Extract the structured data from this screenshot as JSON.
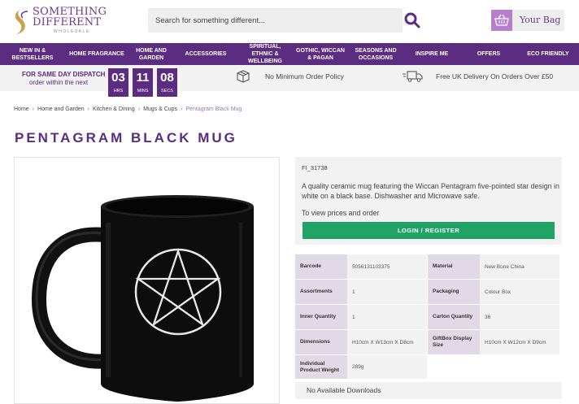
{
  "brand": {
    "line1": "SOMETHING",
    "line2": "DIFFERENT",
    "line3": "WHOLESALE",
    "accent": "#5b2c7f"
  },
  "search": {
    "placeholder": "Search for something different...",
    "icon": "search-icon"
  },
  "bag": {
    "label": "Your Bag",
    "icon": "basket-icon"
  },
  "nav": {
    "items": [
      "NEW IN & BESTSELLERS",
      "HOME FRAGRANCE",
      "HOME AND GARDEN",
      "ACCESSORIES",
      "SPIRITUAL, ETHNIC & WELLBEING",
      "GOTHIC, WICCAN & PAGAN",
      "SEASONS AND OCCASIONS",
      "INSPIRE ME",
      "OFFERS",
      "ECO FRIENDLY"
    ]
  },
  "dispatch": {
    "title": "FOR SAME DAY DISPATCH",
    "subtitle": "order within the next",
    "hours": "03",
    "hours_label": "HRS",
    "mins": "11",
    "mins_label": "MINS",
    "secs": "08",
    "secs_label": "SECS",
    "policy": "No Minimum Order Policy",
    "delivery": "Free UK Delivery On Orders Over £50"
  },
  "breadcrumb": {
    "items": [
      "Home",
      "Home and Garden",
      "Kitchen & Dining",
      "Mugs & Cups"
    ],
    "current": "Pentagram Black Mug"
  },
  "product": {
    "title": "PENTAGRAM BLACK MUG",
    "sku": "FI_31738",
    "description": "A quality ceramic mug featuring the Wiccan Pentagram five-pointed star design in white on a black base. Dishwasher and Microwave safe.",
    "view_prices": "To view prices and order",
    "login_label": "LOGIN / REGISTER"
  },
  "specs": {
    "barcode_label": "Barcode",
    "barcode": "5056131103375",
    "material_label": "Material",
    "material": "New Bone China",
    "assortments_label": "Assortments",
    "assortments": "1",
    "packaging_label": "Packaging",
    "packaging": "Colour Box",
    "inner_label": "Inner Quantity",
    "inner": "1",
    "carton_label": "Carton Quantity",
    "carton": "36",
    "dimensions_label": "Dimensions",
    "dimensions": "H10cm X W13cm X D8cm",
    "giftbox_label": "GiftBox Display Size",
    "giftbox": "H10cm X W12cm X D9cm",
    "weight_label": "Individual Product Weight",
    "weight": "289g"
  },
  "downloads": "No Available Downloads",
  "colors": {
    "purple": "#5b2c7f",
    "green": "#21a366",
    "light_purple": "#e1d9e6"
  }
}
